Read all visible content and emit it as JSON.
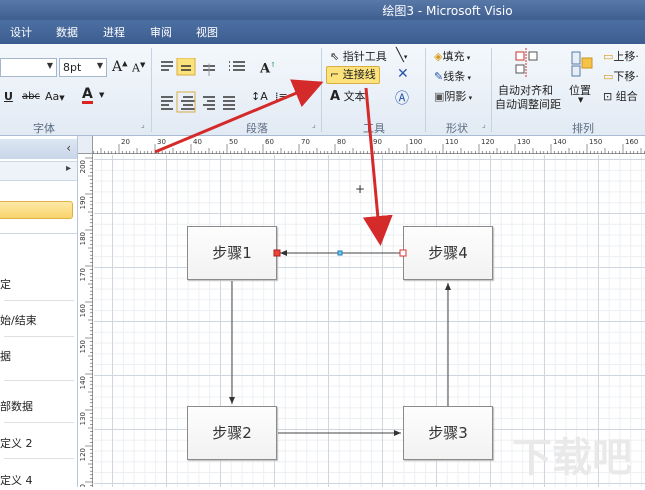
{
  "window": {
    "title": "绘图3 - Microsoft Visio"
  },
  "tabs": [
    "设计",
    "数据",
    "进程",
    "审阅",
    "视图"
  ],
  "font_group": {
    "label": "字体",
    "font_size": "8pt",
    "grow": "A",
    "shrink": "A",
    "underline": "U",
    "strike": "abc",
    "case": "Aa",
    "color": "A"
  },
  "paragraph_group": {
    "label": "段落"
  },
  "tools_group": {
    "label": "工具",
    "pointer": "指针工具",
    "connector": "连接线",
    "text": "文本"
  },
  "shape_group": {
    "label": "形状",
    "fill": "填充",
    "line": "线条",
    "shadow": "阴影"
  },
  "arrange_group": {
    "label": "排列",
    "auto_align_1": "自动对齐和",
    "auto_align_2": "自动调整间距",
    "position": "位置",
    "bring_forward": "上移",
    "send_backward": "下移",
    "group": "组合"
  },
  "sidebar": {
    "items": [
      "定",
      "始/结束",
      "据",
      "部数据",
      "定义 2",
      "定义 4"
    ]
  },
  "ruler": {
    "h_labels": [
      "20",
      "30",
      "40",
      "50",
      "60",
      "70",
      "80",
      "90",
      "100",
      "110",
      "120",
      "130",
      "140",
      "150",
      "160"
    ],
    "v_labels": [
      "200",
      "190",
      "180",
      "170",
      "160",
      "150",
      "140",
      "130",
      "120",
      "110",
      "100",
      "90",
      "80",
      "70",
      "60",
      "50",
      "40",
      "30",
      "20",
      "10",
      "0"
    ]
  },
  "diagram": {
    "step1": "步骤1",
    "step2": "步骤2",
    "step3": "步骤3",
    "step4": "步骤4"
  },
  "watermark": "下载吧",
  "colors": {
    "titlebar": "#4a6ca0",
    "highlight": "#fce27a",
    "annotation_arrow": "#d42a2a"
  }
}
